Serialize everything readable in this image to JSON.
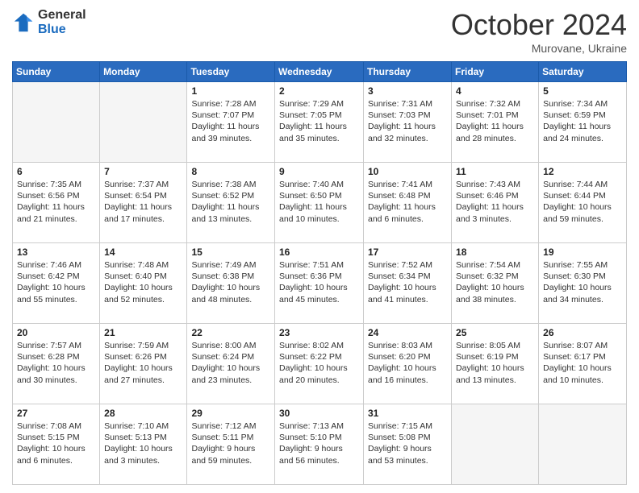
{
  "header": {
    "logo_general": "General",
    "logo_blue": "Blue",
    "month_title": "October 2024",
    "location": "Murovane, Ukraine"
  },
  "days_of_week": [
    "Sunday",
    "Monday",
    "Tuesday",
    "Wednesday",
    "Thursday",
    "Friday",
    "Saturday"
  ],
  "weeks": [
    [
      {
        "day": "",
        "info": ""
      },
      {
        "day": "",
        "info": ""
      },
      {
        "day": "1",
        "info": "Sunrise: 7:28 AM\nSunset: 7:07 PM\nDaylight: 11 hours and 39 minutes."
      },
      {
        "day": "2",
        "info": "Sunrise: 7:29 AM\nSunset: 7:05 PM\nDaylight: 11 hours and 35 minutes."
      },
      {
        "day": "3",
        "info": "Sunrise: 7:31 AM\nSunset: 7:03 PM\nDaylight: 11 hours and 32 minutes."
      },
      {
        "day": "4",
        "info": "Sunrise: 7:32 AM\nSunset: 7:01 PM\nDaylight: 11 hours and 28 minutes."
      },
      {
        "day": "5",
        "info": "Sunrise: 7:34 AM\nSunset: 6:59 PM\nDaylight: 11 hours and 24 minutes."
      }
    ],
    [
      {
        "day": "6",
        "info": "Sunrise: 7:35 AM\nSunset: 6:56 PM\nDaylight: 11 hours and 21 minutes."
      },
      {
        "day": "7",
        "info": "Sunrise: 7:37 AM\nSunset: 6:54 PM\nDaylight: 11 hours and 17 minutes."
      },
      {
        "day": "8",
        "info": "Sunrise: 7:38 AM\nSunset: 6:52 PM\nDaylight: 11 hours and 13 minutes."
      },
      {
        "day": "9",
        "info": "Sunrise: 7:40 AM\nSunset: 6:50 PM\nDaylight: 11 hours and 10 minutes."
      },
      {
        "day": "10",
        "info": "Sunrise: 7:41 AM\nSunset: 6:48 PM\nDaylight: 11 hours and 6 minutes."
      },
      {
        "day": "11",
        "info": "Sunrise: 7:43 AM\nSunset: 6:46 PM\nDaylight: 11 hours and 3 minutes."
      },
      {
        "day": "12",
        "info": "Sunrise: 7:44 AM\nSunset: 6:44 PM\nDaylight: 10 hours and 59 minutes."
      }
    ],
    [
      {
        "day": "13",
        "info": "Sunrise: 7:46 AM\nSunset: 6:42 PM\nDaylight: 10 hours and 55 minutes."
      },
      {
        "day": "14",
        "info": "Sunrise: 7:48 AM\nSunset: 6:40 PM\nDaylight: 10 hours and 52 minutes."
      },
      {
        "day": "15",
        "info": "Sunrise: 7:49 AM\nSunset: 6:38 PM\nDaylight: 10 hours and 48 minutes."
      },
      {
        "day": "16",
        "info": "Sunrise: 7:51 AM\nSunset: 6:36 PM\nDaylight: 10 hours and 45 minutes."
      },
      {
        "day": "17",
        "info": "Sunrise: 7:52 AM\nSunset: 6:34 PM\nDaylight: 10 hours and 41 minutes."
      },
      {
        "day": "18",
        "info": "Sunrise: 7:54 AM\nSunset: 6:32 PM\nDaylight: 10 hours and 38 minutes."
      },
      {
        "day": "19",
        "info": "Sunrise: 7:55 AM\nSunset: 6:30 PM\nDaylight: 10 hours and 34 minutes."
      }
    ],
    [
      {
        "day": "20",
        "info": "Sunrise: 7:57 AM\nSunset: 6:28 PM\nDaylight: 10 hours and 30 minutes."
      },
      {
        "day": "21",
        "info": "Sunrise: 7:59 AM\nSunset: 6:26 PM\nDaylight: 10 hours and 27 minutes."
      },
      {
        "day": "22",
        "info": "Sunrise: 8:00 AM\nSunset: 6:24 PM\nDaylight: 10 hours and 23 minutes."
      },
      {
        "day": "23",
        "info": "Sunrise: 8:02 AM\nSunset: 6:22 PM\nDaylight: 10 hours and 20 minutes."
      },
      {
        "day": "24",
        "info": "Sunrise: 8:03 AM\nSunset: 6:20 PM\nDaylight: 10 hours and 16 minutes."
      },
      {
        "day": "25",
        "info": "Sunrise: 8:05 AM\nSunset: 6:19 PM\nDaylight: 10 hours and 13 minutes."
      },
      {
        "day": "26",
        "info": "Sunrise: 8:07 AM\nSunset: 6:17 PM\nDaylight: 10 hours and 10 minutes."
      }
    ],
    [
      {
        "day": "27",
        "info": "Sunrise: 7:08 AM\nSunset: 5:15 PM\nDaylight: 10 hours and 6 minutes."
      },
      {
        "day": "28",
        "info": "Sunrise: 7:10 AM\nSunset: 5:13 PM\nDaylight: 10 hours and 3 minutes."
      },
      {
        "day": "29",
        "info": "Sunrise: 7:12 AM\nSunset: 5:11 PM\nDaylight: 9 hours and 59 minutes."
      },
      {
        "day": "30",
        "info": "Sunrise: 7:13 AM\nSunset: 5:10 PM\nDaylight: 9 hours and 56 minutes."
      },
      {
        "day": "31",
        "info": "Sunrise: 7:15 AM\nSunset: 5:08 PM\nDaylight: 9 hours and 53 minutes."
      },
      {
        "day": "",
        "info": ""
      },
      {
        "day": "",
        "info": ""
      }
    ]
  ]
}
